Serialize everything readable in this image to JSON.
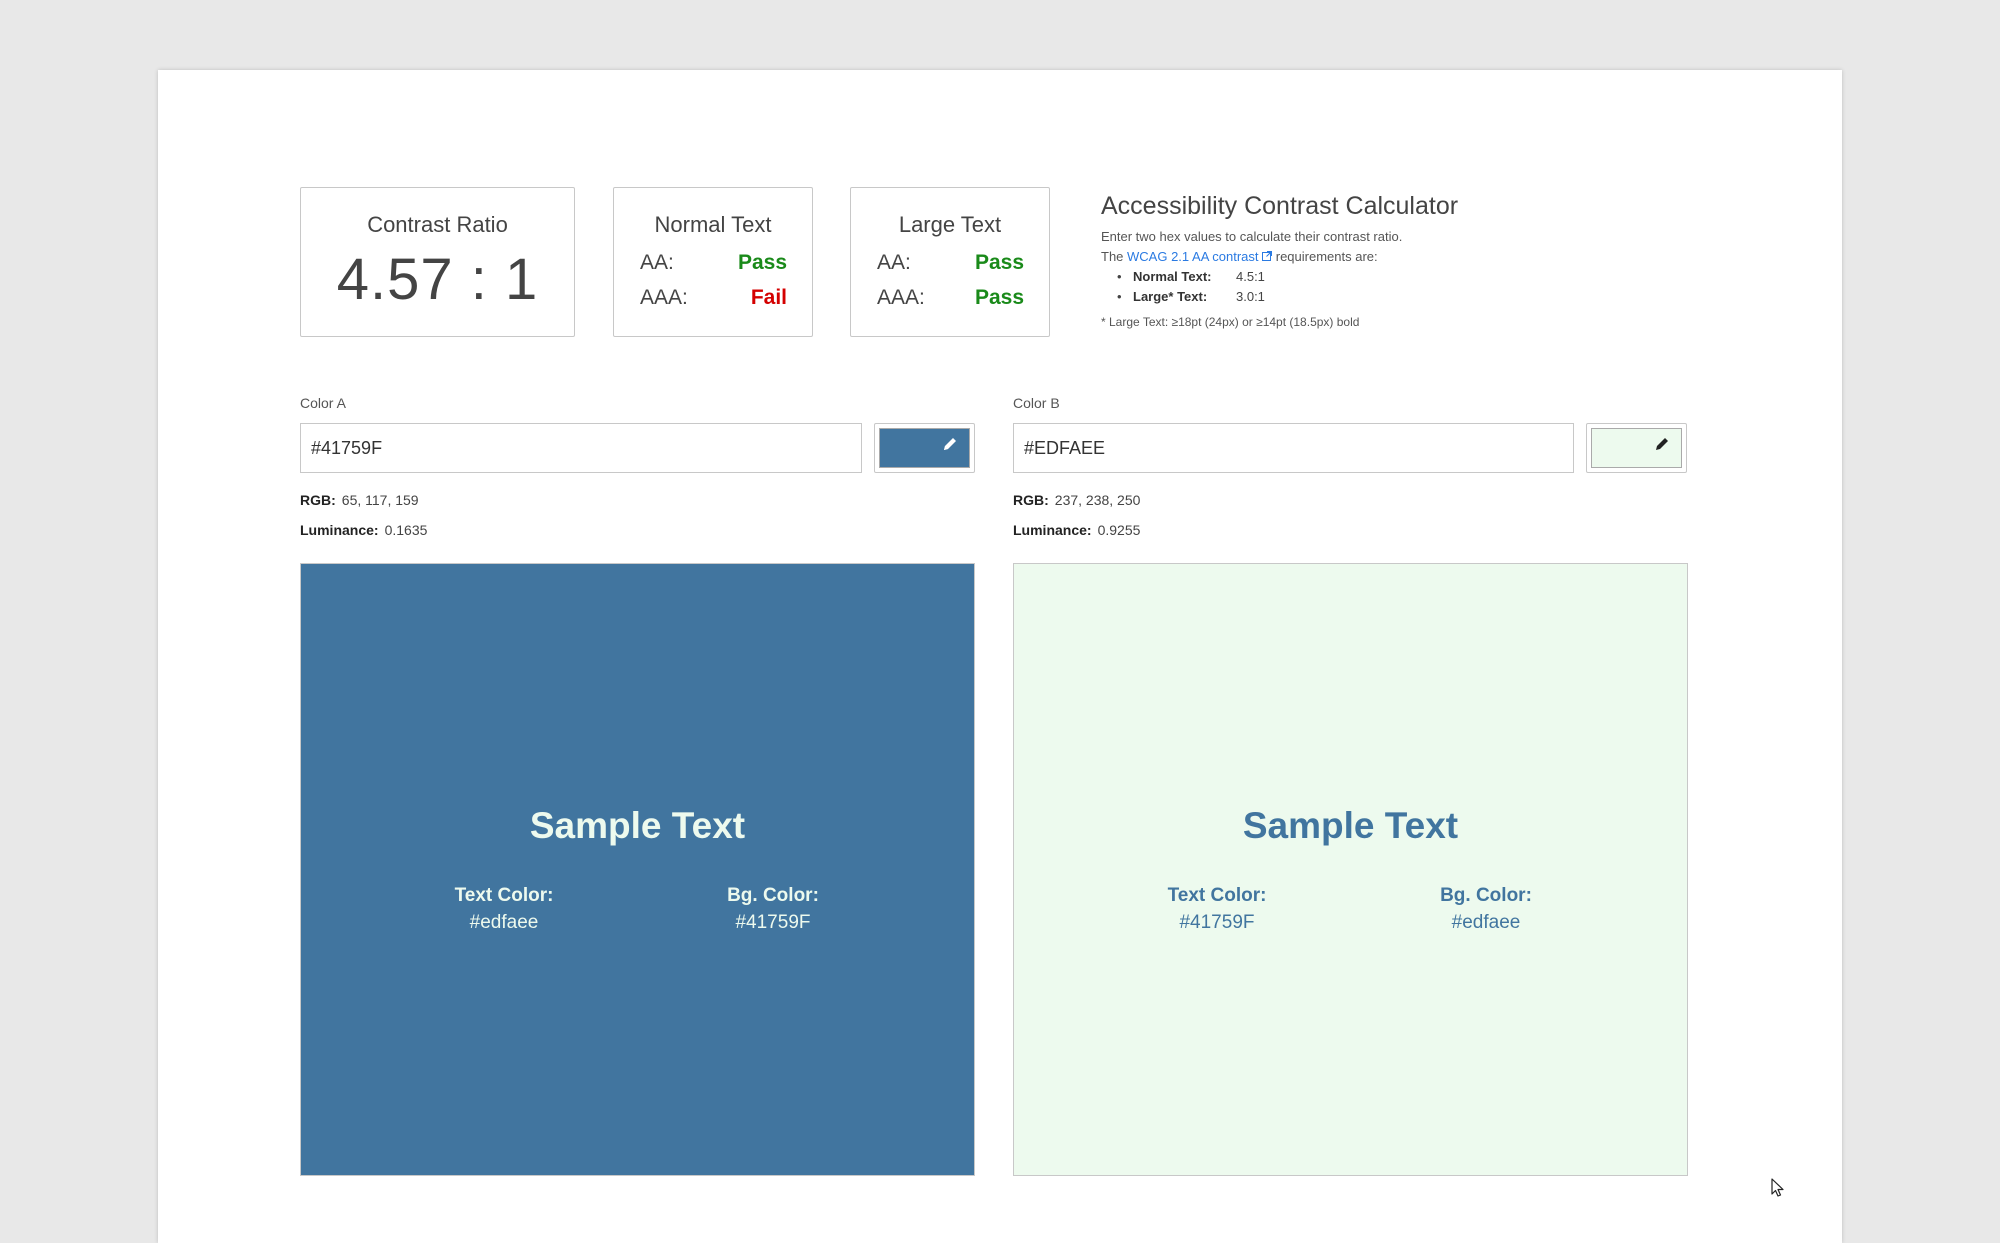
{
  "cards": {
    "contrast": {
      "title": "Contrast Ratio",
      "value": "4.57 : 1"
    },
    "normal": {
      "title": "Normal Text",
      "aa_label": "AA:",
      "aa_result": "Pass",
      "aaa_label": "AAA:",
      "aaa_result": "Fail"
    },
    "large": {
      "title": "Large Text",
      "aa_label": "AA:",
      "aa_result": "Pass",
      "aaa_label": "AAA:",
      "aaa_result": "Pass"
    }
  },
  "info": {
    "title": "Accessibility Contrast Calculator",
    "intro": "Enter two hex values to calculate their contrast ratio.",
    "req_prefix": "The ",
    "req_link": "WCAG 2.1 AA contrast",
    "req_suffix": " requirements are:",
    "requirements": [
      {
        "label": "Normal Text:",
        "value": "4.5:1"
      },
      {
        "label": "Large* Text:",
        "value": "3.0:1"
      }
    ],
    "footnote": "* Large Text: ≥18pt (24px) or ≥14pt (18.5px) bold"
  },
  "colorA": {
    "label": "Color A",
    "hex": "#41759F",
    "swatch": "#41759f",
    "rgb_label": "RGB:",
    "rgb": "65, 117, 159",
    "lum_label": "Luminance:",
    "luminance": "0.1635"
  },
  "colorB": {
    "label": "Color B",
    "hex": "#EDFAEE",
    "swatch": "#edfaee",
    "rgb_label": "RGB:",
    "rgb": "237, 238, 250",
    "lum_label": "Luminance:",
    "luminance": "0.9255"
  },
  "sampleA": {
    "title": "Sample Text",
    "text_color_label": "Text Color:",
    "text_color": "#edfaee",
    "bg_color_label": "Bg. Color:",
    "bg_color": "#41759F"
  },
  "sampleB": {
    "title": "Sample Text",
    "text_color_label": "Text Color:",
    "text_color": "#41759F",
    "bg_color_label": "Bg. Color:",
    "bg_color": "#edfaee"
  },
  "colors": {
    "pass": "#1a8a1a",
    "fail": "#d40000",
    "link": "#2a7ae2"
  },
  "icons": {
    "picker": "pencil-icon",
    "external": "external-link-icon",
    "cursor": "mouse-pointer-icon"
  }
}
